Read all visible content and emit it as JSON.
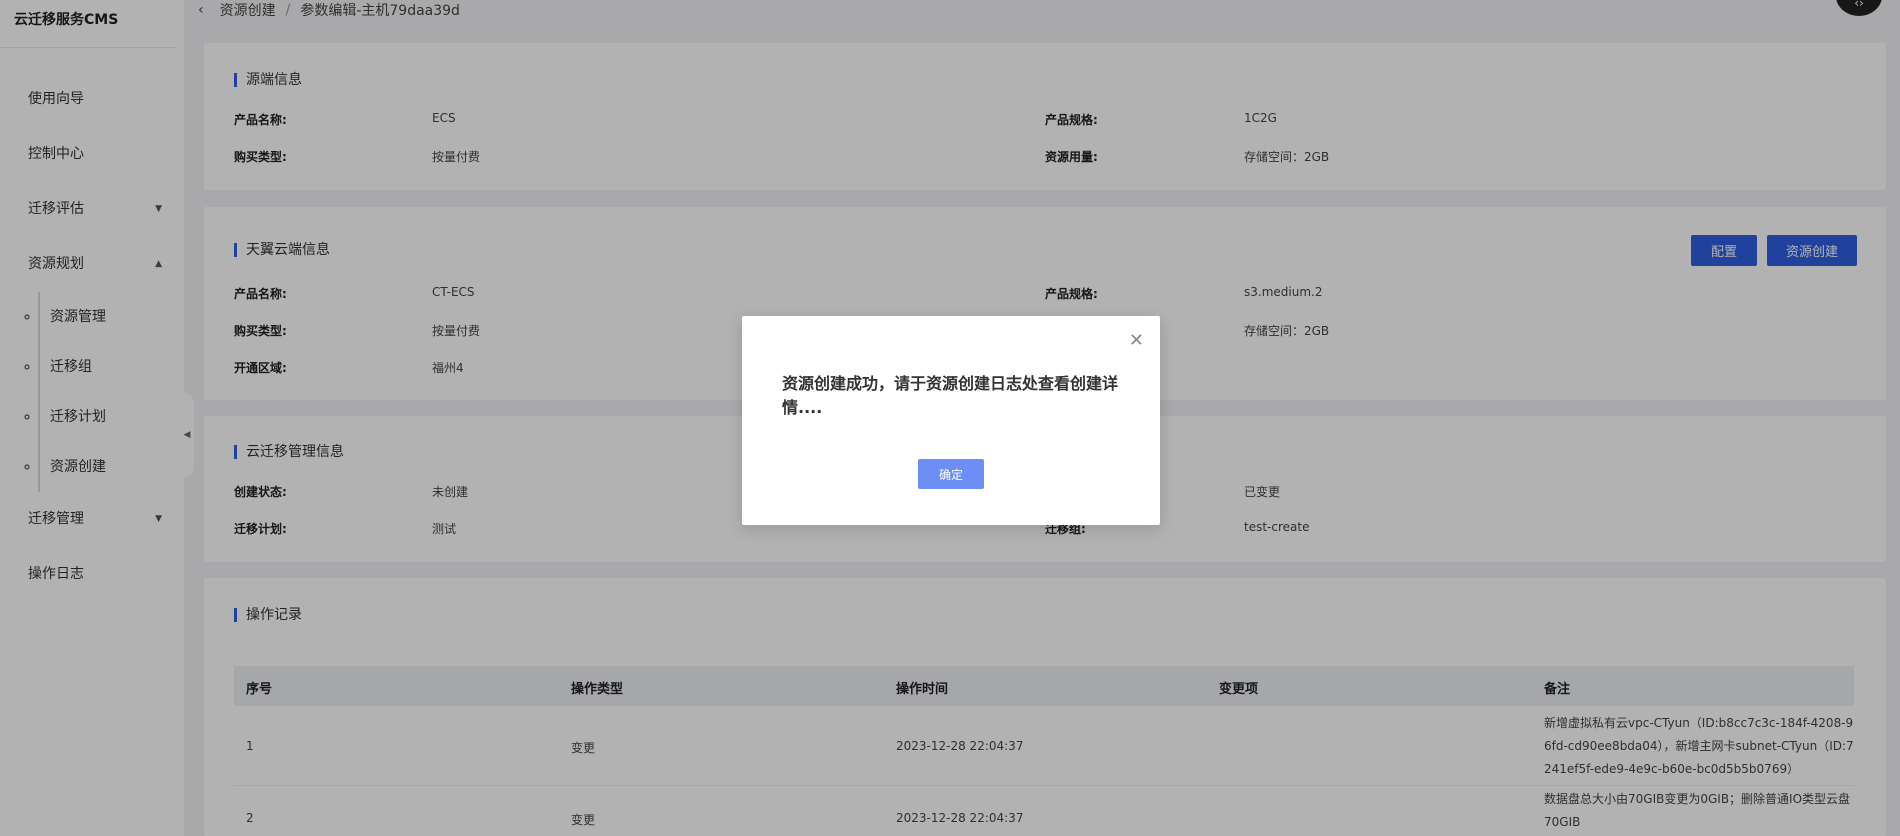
{
  "app": {
    "brand": "云迁移服务CMS"
  },
  "sidebar": {
    "items": [
      {
        "label": "使用向导"
      },
      {
        "label": "控制中心"
      },
      {
        "label": "迁移评估"
      },
      {
        "label": "资源规划"
      },
      {
        "label": "迁移管理"
      },
      {
        "label": "操作日志"
      }
    ],
    "subitems": [
      {
        "label": "资源管理"
      },
      {
        "label": "迁移组"
      },
      {
        "label": "迁移计划"
      },
      {
        "label": "资源创建"
      }
    ]
  },
  "breadcrumb": {
    "parent": "资源创建",
    "sep": "/",
    "current": "参数编辑-主机79daa39d"
  },
  "source": {
    "title": "源端信息",
    "product_name_label": "产品名称:",
    "product_name": "ECS",
    "spec_label": "产品规格:",
    "spec": "1C2G",
    "purchase_label": "购买类型:",
    "purchase": "按量付费",
    "usage_label": "资源用量:",
    "usage": "存储空间：2GB"
  },
  "ctyun": {
    "title": "天翼云端信息",
    "config_button": "配置",
    "create_button": "资源创建",
    "product_name_label": "产品名称:",
    "product_name": "CT-ECS",
    "spec_label": "产品规格:",
    "spec": "s3.medium.2",
    "purchase_label": "购买类型:",
    "purchase": "按量付费",
    "usage": "存储空间：2GB",
    "region_label": "开通区域:",
    "region": "福州4"
  },
  "mgmt": {
    "title": "云迁移管理信息",
    "status_label": "创建状态:",
    "status": "未创建",
    "changed": "已变更",
    "plan_label": "迁移计划:",
    "plan": "测试",
    "group_label": "迁移组:",
    "group": "test-create"
  },
  "records": {
    "title": "操作记录",
    "columns": [
      "序号",
      "操作类型",
      "操作时间",
      "变更项",
      "备注"
    ],
    "rows": [
      {
        "no": "1",
        "type": "变更",
        "time": "2023-12-28 22:04:37",
        "item": "",
        "note": "新增虚拟私有云vpc-CTyun（ID:b8cc7c3c-184f-4208-96fd-cd90ee8bda04），新增主网卡subnet-CTyun（ID:7241ef5f-ede9-4e9c-b60e-bc0d5b5b0769）"
      },
      {
        "no": "2",
        "type": "变更",
        "time": "2023-12-28 22:04:37",
        "item": "",
        "note": "数据盘总大小由70GIB变更为0GIB；删除普通IO类型云盘70GIB"
      }
    ]
  },
  "modal": {
    "message": "资源创建成功，请于资源创建日志处查看创建详情....",
    "ok_label": "确定"
  },
  "colors": {
    "primary": "#2f5fe0",
    "modal_button": "#6d8ff5"
  }
}
